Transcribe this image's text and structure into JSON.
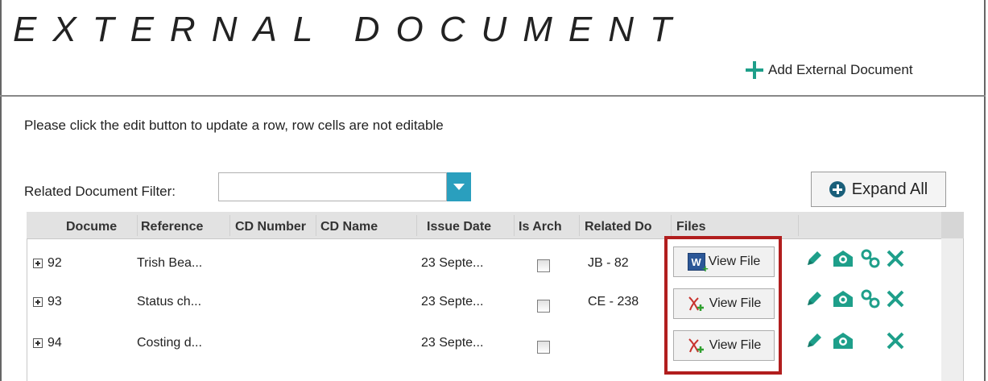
{
  "page": {
    "title": "EXTERNAL DOCUMENT",
    "add_label": "Add External Document",
    "instruction": "Please click the edit button to update a row, row cells are not editable",
    "filter_label": "Related Document Filter:",
    "filter_value": "",
    "expand_label": "Expand All"
  },
  "grid": {
    "columns": [
      "Docume",
      "Reference",
      "CD Number",
      "CD Name",
      "Issue Date",
      "Is Arch",
      "Related Do",
      "Files"
    ],
    "rows": [
      {
        "doc": "92",
        "reference": "Trish Bea...",
        "cd_number": "",
        "cd_name": "",
        "issue_date": "23 Septe...",
        "is_archived": false,
        "related": "JB - 82",
        "file_type": "word-icon",
        "file_label": "View File",
        "actions": [
          "edit",
          "view",
          "link",
          "delete"
        ]
      },
      {
        "doc": "93",
        "reference": "Status ch...",
        "cd_number": "",
        "cd_name": "",
        "issue_date": "23 Septe...",
        "is_archived": false,
        "related": "CE - 238",
        "file_type": "pdf-icon",
        "file_label": "View File",
        "actions": [
          "edit",
          "view",
          "link",
          "delete"
        ]
      },
      {
        "doc": "94",
        "reference": "Costing d...",
        "cd_number": "",
        "cd_name": "",
        "issue_date": "23 Septe...",
        "is_archived": false,
        "related": "",
        "file_type": "pdf-icon",
        "file_label": "View File",
        "actions": [
          "edit",
          "view",
          "delete"
        ]
      }
    ]
  },
  "colors": {
    "accent": "#1e9f8a",
    "dropdown": "#2a9fbe",
    "highlight": "#b11e1e"
  }
}
